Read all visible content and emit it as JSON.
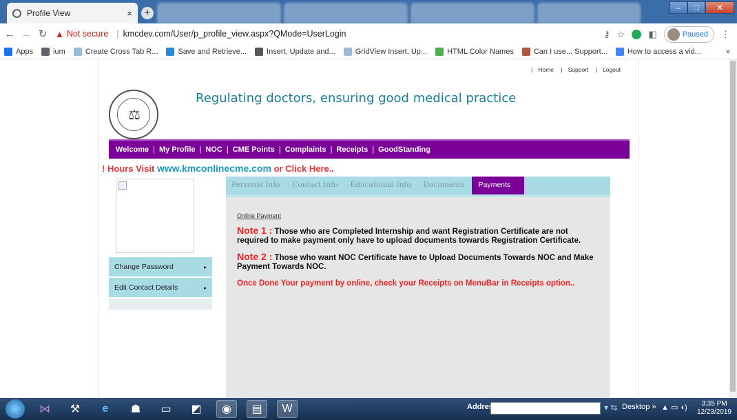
{
  "browser": {
    "active_tab_title": "Profile View",
    "url_warning": "Not secure",
    "url": "kmcdev.com/User/p_profile_view.aspx?QMode=UserLogin",
    "profile_status": "Paused"
  },
  "bookmarks": [
    {
      "label": "Apps",
      "icon": "apps-grid-icon",
      "color": "#1a73e8"
    },
    {
      "label": "ium",
      "icon": "globe-icon",
      "color": "#5f6368"
    },
    {
      "label": "Create Cross Tab R...",
      "icon": "page-icon",
      "color": "#9bbcd6"
    },
    {
      "label": "Save and Retrieve...",
      "icon": "circle-icon",
      "color": "#2a8ad4"
    },
    {
      "label": "Insert, Update and...",
      "icon": "link-icon",
      "color": "#555"
    },
    {
      "label": "GridView Insert, Up...",
      "icon": "page-icon",
      "color": "#9bbcd6"
    },
    {
      "label": "HTML Color Names",
      "icon": "w3-icon",
      "color": "#4caf50"
    },
    {
      "label": "Can I use... Support...",
      "icon": "caniuse-icon",
      "color": "#b0563c"
    },
    {
      "label": "How to access a vid...",
      "icon": "google-icon",
      "color": "#4285f4"
    }
  ],
  "site": {
    "top_links": [
      "Home",
      "Support",
      "Logout"
    ],
    "tagline": "Regulating doctors, ensuring good medical practice",
    "menu": [
      "Welcome",
      "My Profile",
      "NOC",
      "CME Points",
      "Complaints",
      "Receipts",
      "GoodStanding"
    ],
    "marquee_prefix": "! Hours Visit ",
    "marquee_site": "www.kmconlinecme.com",
    "marquee_suffix": " or Click Here..",
    "side_menu": [
      "Change Password",
      "Edit Contact Details"
    ],
    "tabs": [
      "Personal Info",
      "Contact Info",
      "Educational Info",
      "Documents",
      "Payments"
    ],
    "selected_tab": "Payments",
    "online_payment_link": "Online Payment",
    "note1_label": "Note 1 :",
    "note1_text": " Those who are Completed Internship and want Registration Certificate are not required to make payment only have to upload documents towards Registration Certificate.",
    "note2_label": "Note 2 :",
    "note2_text": " Those who want NOC Certificate have to Upload Documents Towards NOC and Make Payment Towards NOC.",
    "done_text": "Once Done Your payment by online, check your Receipts on MenuBar in Receipts option..",
    "accent": "#7b0099",
    "tab_color": "#a9dbe4",
    "note_color": "#e22222"
  },
  "taskbar": {
    "address_label": "Address",
    "desktop_label": "Desktop",
    "time": "3:35 PM",
    "date": "12/23/2019"
  }
}
